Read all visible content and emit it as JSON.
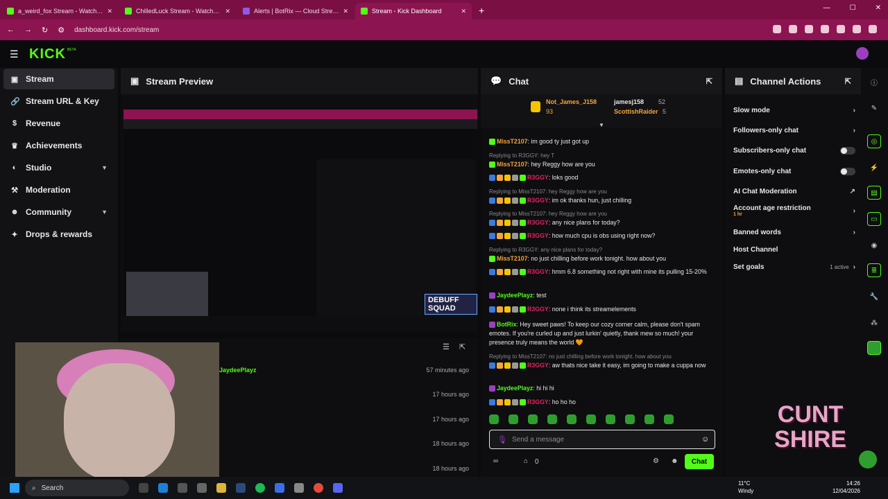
{
  "browser": {
    "tabs": [
      {
        "title": "a_weird_fox Stream - Watch Live",
        "active": false
      },
      {
        "title": "ChilledLuck Stream - Watch Live",
        "active": false
      },
      {
        "title": "Alerts | BotRix — Cloud Stream",
        "active": false
      },
      {
        "title": "Stream - Kick Dashboard",
        "active": true
      }
    ],
    "url": "dashboard.kick.com/stream"
  },
  "header": {
    "logo": "KICK",
    "beta": "BETA"
  },
  "sidebar": {
    "items": [
      {
        "label": "Stream",
        "icon": "video-icon",
        "active": true
      },
      {
        "label": "Stream URL & Key",
        "icon": "link-icon"
      },
      {
        "label": "Revenue",
        "icon": "dollar-icon"
      },
      {
        "label": "Achievements",
        "icon": "trophy-icon"
      },
      {
        "label": "Studio",
        "icon": "palette-icon",
        "expand": true
      },
      {
        "label": "Moderation",
        "icon": "hammer-icon"
      },
      {
        "label": "Community",
        "icon": "people-icon",
        "expand": true
      },
      {
        "label": "Drops & rewards",
        "icon": "gift-icon"
      }
    ]
  },
  "preview": {
    "title": "Stream Preview",
    "overlay": "DEBUFF SQUAD"
  },
  "events": {
    "rows": [
      {
        "user": "JaydeePlayz",
        "time": "57 minutes ago"
      },
      {
        "user": "",
        "time": "17 hours ago"
      },
      {
        "user": "",
        "time": "17 hours ago"
      },
      {
        "user": "",
        "time": "18 hours ago"
      },
      {
        "user": "",
        "time": "18 hours ago"
      }
    ]
  },
  "chat": {
    "title": "Chat",
    "pinned": {
      "top_user": "Not_James_J158",
      "top_count": "93",
      "u2": "jamesj158",
      "u2_count": "52",
      "u3": "ScottishRaider",
      "u3_count": "5"
    },
    "messages": [
      {
        "reply": "",
        "user": "MissT2107",
        "color": "orange",
        "text": ": im good ty just got up"
      },
      {
        "reply": "Replying to R3GGY: hey T",
        "user": "MissT2107",
        "color": "orange",
        "text": ": hey Reggy how are you"
      },
      {
        "reply": "",
        "user": "R3GGY",
        "color": "red",
        "text": ": loks good"
      },
      {
        "reply": "Replying to MissT2107: hey Reggy how are you",
        "user": "R3GGY",
        "color": "red",
        "text": ": im ok thanks hun, just chilling"
      },
      {
        "reply": "Replying to MissT2107: hey Reggy how are you",
        "user": "R3GGY",
        "color": "red",
        "text": ": any nice plans for today?"
      },
      {
        "reply": "",
        "user": "R3GGY",
        "color": "red",
        "text": ": how much cpu is obs using right now?"
      },
      {
        "reply": "Replying to R3GGY: any nice plans for today?",
        "user": "MissT2107",
        "color": "orange",
        "text": ": no just chilling before work tonight. how about you"
      },
      {
        "reply": "",
        "user": "R3GGY",
        "color": "red",
        "text": ": hmm 6.8 something not right with mine its pulling 15-20%"
      },
      {
        "reply": "",
        "user": "JaydeePlayz",
        "color": "green",
        "text": ": test"
      },
      {
        "reply": "",
        "user": "R3GGY",
        "color": "red",
        "text": ": none i think its streamelements"
      },
      {
        "reply": "",
        "user": "BotRix",
        "color": "green",
        "text": ": Hey sweet paws! To keep our cozy corner calm, please don't spam emotes. If you're curled up and just lurkin' quietly, thank mew so much! your presence truly means the world 🧡"
      },
      {
        "reply": "Replying to MissT2107: no just chilling before work tonight. how about you",
        "user": "R3GGY",
        "color": "red",
        "text": ": aw thats nice take it easy, im going to make a cuppa now"
      },
      {
        "reply": "",
        "user": "JaydeePlayz",
        "color": "green",
        "text": ": hi hi hi"
      },
      {
        "reply": "",
        "user": "R3GGY",
        "color": "red",
        "text": ": ho ho ho"
      }
    ],
    "input_placeholder": "Send a message",
    "points": "0",
    "send_label": "Chat"
  },
  "actions": {
    "title": "Channel Actions",
    "items": [
      {
        "label": "Slow mode",
        "kind": "chevron"
      },
      {
        "label": "Followers-only chat",
        "kind": "chevron"
      },
      {
        "label": "Subscribers-only chat",
        "kind": "toggle"
      },
      {
        "label": "Emotes-only chat",
        "kind": "toggle"
      },
      {
        "label": "AI Chat Moderation",
        "kind": "link"
      },
      {
        "label": "Account age restriction",
        "sub": "1 hr",
        "kind": "chevron"
      },
      {
        "label": "Banned words",
        "kind": "chevron"
      },
      {
        "label": "Host Channel",
        "kind": "none"
      },
      {
        "label": "Set goals",
        "sub": "1 active",
        "kind": "chevron"
      }
    ]
  },
  "overlay_logo": "CUNT SHIRE",
  "taskbar": {
    "search": "Search",
    "weather_temp": "11°C",
    "weather": "Windy",
    "time": "14:26",
    "date": "12/04/2026"
  },
  "colors": {
    "brand": "#53fc18",
    "tab_bg": "#7a0f44",
    "addr_bg": "#8c1450"
  }
}
